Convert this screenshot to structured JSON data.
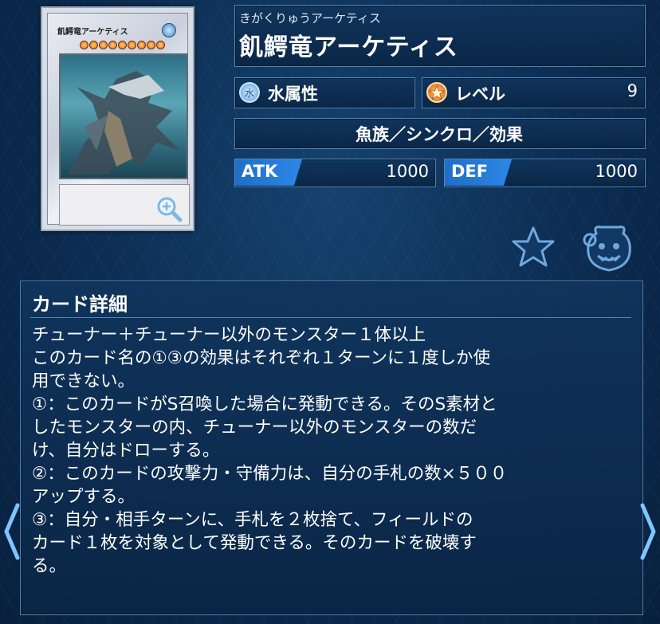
{
  "card": {
    "reading": "きがくりゅうアーケティス",
    "name": "飢鰐竜アーケティス",
    "thumb_name": "飢鰐竜アーケティス",
    "attribute_label": "水属性",
    "level_label": "レベル",
    "level_value": "9",
    "type_line": "魚族／シンクロ／効果",
    "atk_label": "ATK",
    "atk_value": "1000",
    "def_label": "DEF",
    "def_value": "1000",
    "level_stars": 9
  },
  "detail": {
    "title": "カード詳細",
    "text": "チューナー＋チューナー以外のモンスター１体以上\nこのカード名の①③の効果はそれぞれ１ターンに１度しか使\n用できない。\n①：このカードがS召喚した場合に発動できる。そのS素材と\nしたモンスターの内、チューナー以外のモンスターの数だ\nけ、自分はドローする。\n②：このカードの攻撃力・守備力は、自分の手札の数×５００\nアップする。\n③：自分・相手ターンに、手札を２枚捨て、フィールドの\nカード１枚を対象として発動できる。そのカードを破壊す\nる。"
  },
  "icons": {
    "attribute": "water-attribute-icon",
    "level": "level-star-icon",
    "favorite": "star-outline-icon",
    "deck": "pot-of-greed-icon",
    "zoom": "zoom-in-icon",
    "prev": "chevron-left-icon",
    "next": "chevron-right-icon"
  },
  "colors": {
    "accent": "#2d86e6",
    "panel_border": "#4f86b8",
    "background": "#0b2a4e"
  }
}
